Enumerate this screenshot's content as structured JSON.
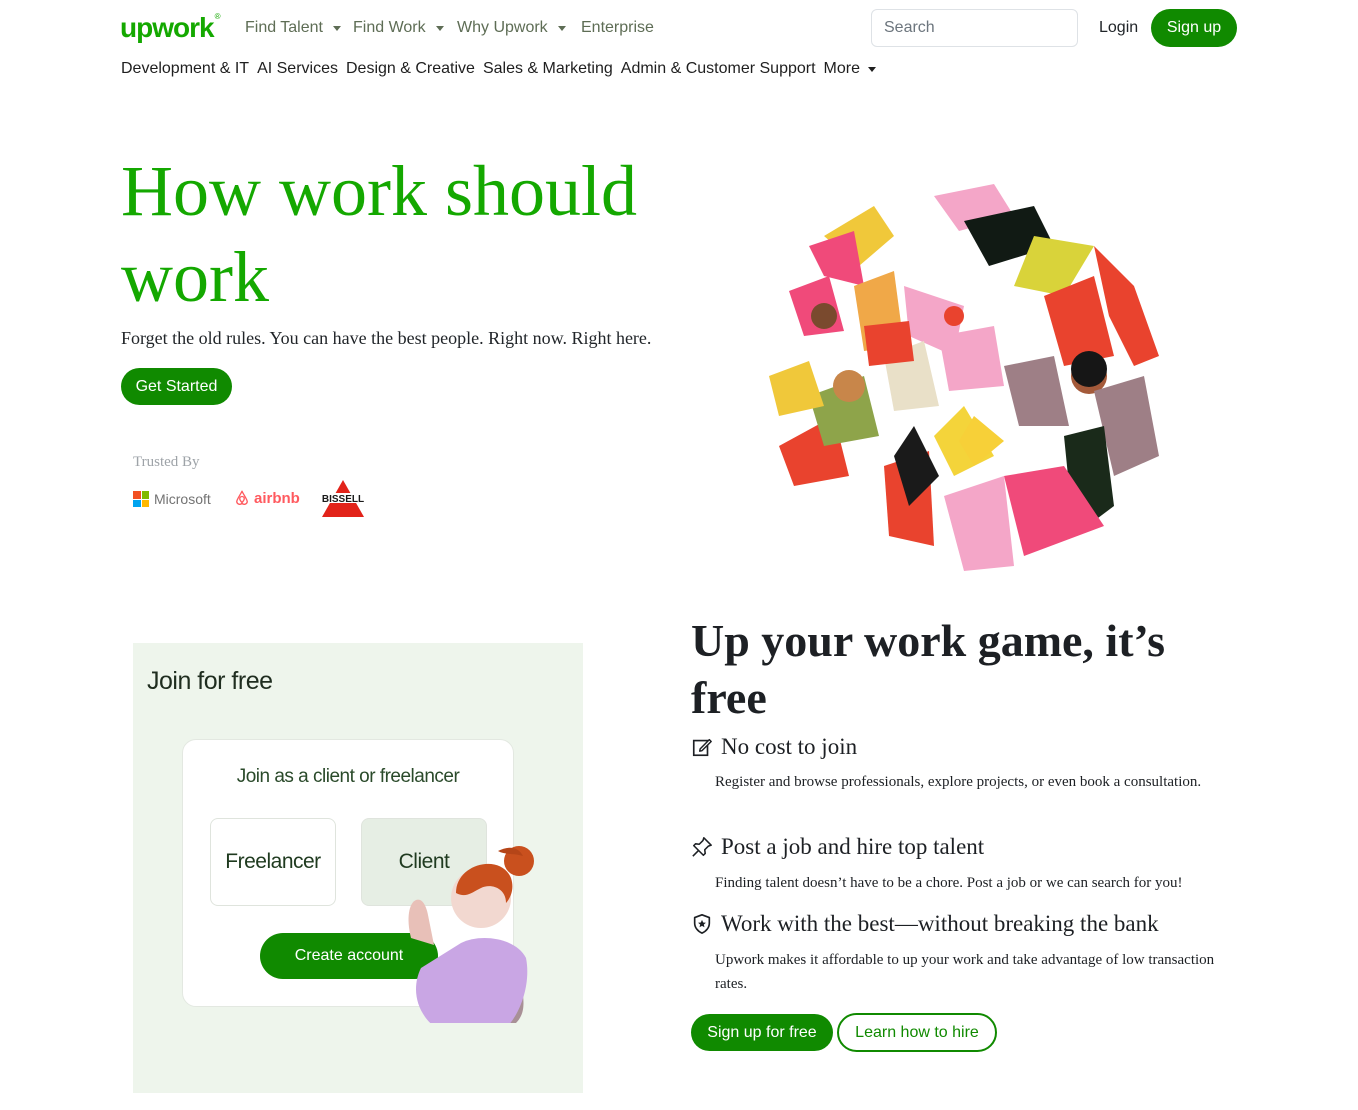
{
  "header": {
    "logo_text": "upwork",
    "logo_mark": "®",
    "nav": [
      {
        "label": "Find Talent",
        "has_dropdown": true
      },
      {
        "label": "Find Work",
        "has_dropdown": true
      },
      {
        "label": "Why Upwork",
        "has_dropdown": true
      },
      {
        "label": "Enterprise",
        "has_dropdown": false
      }
    ],
    "search_placeholder": "Search",
    "search_value": "",
    "login_label": "Login",
    "signup_label": "Sign up"
  },
  "categories": [
    "Development & IT",
    "AI Services",
    "Design & Creative",
    "Sales & Marketing",
    "Admin & Customer Support",
    "More"
  ],
  "hero": {
    "title": "How work should work",
    "subtitle": "Forget the old rules. You can have the best people. Right now. Right here.",
    "cta_label": "Get Started",
    "trusted_label": "Trusted By",
    "brands": {
      "microsoft": "Microsoft",
      "airbnb": "airbnb",
      "bissell": "BISSELL"
    }
  },
  "join_panel": {
    "heading": "Join for free",
    "card_title": "Join as a client or freelancer",
    "option_freelancer": "Freelancer",
    "option_client": "Client",
    "create_label": "Create account"
  },
  "section": {
    "title": "Up your work game, it’s free",
    "features": [
      {
        "icon": "edit-square-icon",
        "title": "No cost to join",
        "desc": "Register and browse professionals, explore projects, or even book a consultation."
      },
      {
        "icon": "pin-icon",
        "title": "Post a job and hire top talent",
        "desc": "Finding talent doesn’t have to be a chore. Post a job or we can search for you!"
      },
      {
        "icon": "shield-star-icon",
        "title": "Work with the best—without breaking the bank",
        "desc": "Upwork makes it affordable to up your work and take advantage of low transaction rates."
      }
    ],
    "signup_free_label": "Sign up for free",
    "learn_label": "Learn how to hire"
  },
  "colors": {
    "brand_green": "#14a800",
    "button_green": "#108a00",
    "text": "#212529",
    "muted_nav": "#5e6d55"
  }
}
